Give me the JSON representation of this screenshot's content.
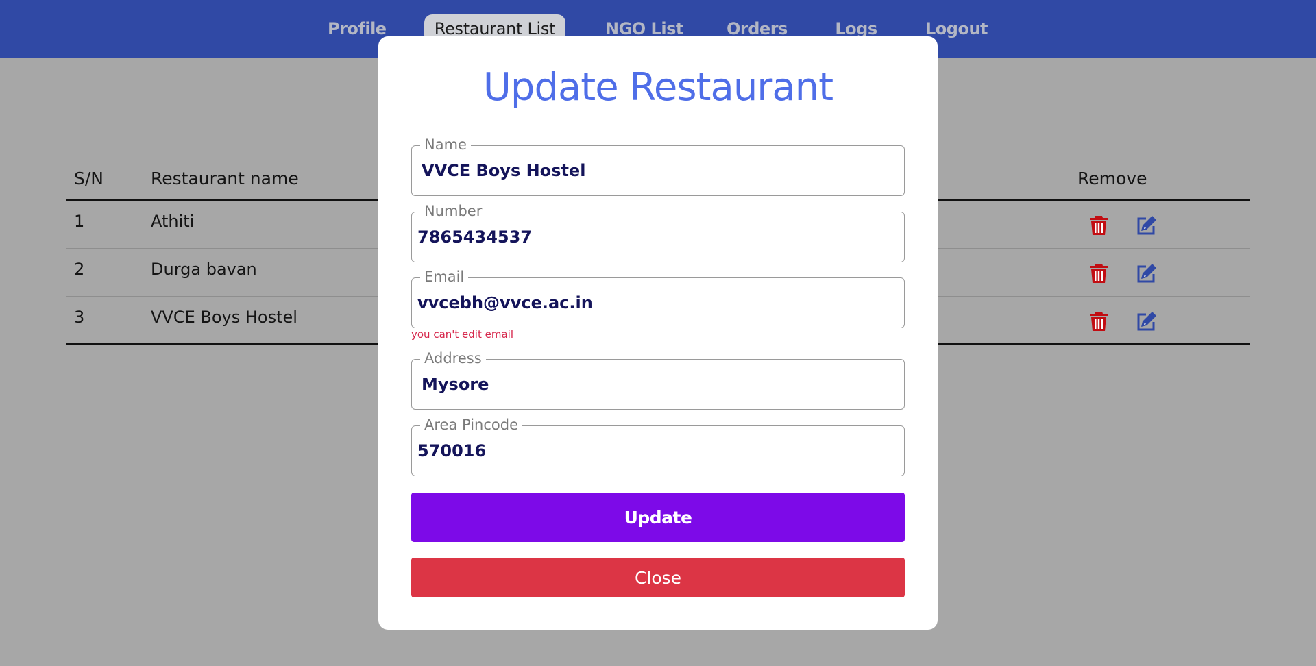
{
  "nav": {
    "items": [
      {
        "label": "Profile"
      },
      {
        "label": "Restaurant List",
        "active": true
      },
      {
        "label": "NGO List"
      },
      {
        "label": "Orders"
      },
      {
        "label": "Logs"
      },
      {
        "label": "Logout"
      }
    ]
  },
  "table": {
    "headers": {
      "sn": "S/N",
      "name": "Restaurant name",
      "remove": "Remove"
    },
    "rows": [
      {
        "sn": "1",
        "name": "Athiti"
      },
      {
        "sn": "2",
        "name": "Durga bavan"
      },
      {
        "sn": "3",
        "name": "VVCE Boys Hostel"
      }
    ],
    "icons": {
      "delete": "trash-icon",
      "edit": "edit-icon"
    }
  },
  "modal": {
    "title": "Update Restaurant",
    "fields": {
      "name": {
        "label": "Name",
        "value": "VVCE Boys Hostel"
      },
      "number": {
        "label": "Number",
        "value": "7865434537"
      },
      "email": {
        "label": "Email",
        "value": "vvcebh@vvce.ac.in",
        "hint": "you can't edit email"
      },
      "address": {
        "label": "Address",
        "value": "Mysore"
      },
      "pincode": {
        "label": "Area Pincode",
        "value": "570016"
      }
    },
    "update_label": "Update",
    "close_label": "Close"
  },
  "colors": {
    "nav_bg": "#3049a5",
    "title": "#4f6ee8",
    "update_button": "#7d0ae8",
    "close_button": "#dc3545",
    "delete_icon": "#c20d12",
    "edit_icon": "#3049a5"
  }
}
